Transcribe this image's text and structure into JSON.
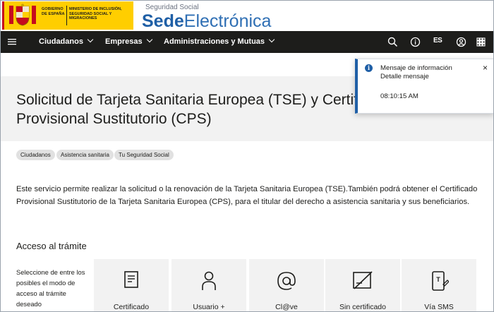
{
  "header": {
    "gov_text": "GOBIERNO DE ESPAÑA",
    "ministry_text": "MINISTERIO DE INCLUSIÓN, SEGURIDAD SOCIAL Y MIGRACIONES",
    "seg_social": "Seguridad Social",
    "sede_bold": "Sede",
    "sede_light": "Electrónica"
  },
  "nav": {
    "items": [
      {
        "label": "Ciudadanos"
      },
      {
        "label": "Empresas"
      },
      {
        "label": "Administraciones y Mutuas"
      }
    ],
    "lang": "ES",
    "icons": [
      "menu-icon",
      "search-icon",
      "info-icon",
      "language-icon",
      "user-icon",
      "apps-icon"
    ]
  },
  "page": {
    "title": "Solicitud de Tarjeta Sanitaria Europea (TSE) y Certificado Provisional Sustitutorio (CPS)",
    "tags": [
      "Ciudadanos",
      "Asistencia sanitaria",
      "Tu Seguridad Social"
    ],
    "description": "Este servicio permite realizar la solicitud o la renovación de la Tarjeta Sanitaria Europea (TSE).También podrá obtener el Certificado Provisional Sustitutorio de la Tarjeta Sanitaria Europea (CPS), para el titular del derecho a asistencia sanitaria y sus beneficiarios.",
    "access_heading": "Acceso al trámite",
    "access_hint": "Seleccione de entre los posibles el modo de acceso al trámite deseado",
    "access_options": [
      {
        "label": "Certificado",
        "icon": "certificate-icon"
      },
      {
        "label": "Usuario +",
        "icon": "user-plus-icon"
      },
      {
        "label": "Cl@ve",
        "icon": "at-icon"
      },
      {
        "label": "Sin certificado",
        "icon": "no-certificate-icon"
      },
      {
        "label": "Vía SMS",
        "icon": "sms-phone-icon"
      }
    ]
  },
  "toast": {
    "title": "Mensaje de información",
    "detail": "Detalle mensaje",
    "time": "08:10:15 AM",
    "close": "×"
  },
  "colors": {
    "nav_bg": "#1d1d1b",
    "brand_blue": "#1f5fa6",
    "gov_yellow": "#ffce00",
    "band_gray": "#f2f2f2"
  }
}
